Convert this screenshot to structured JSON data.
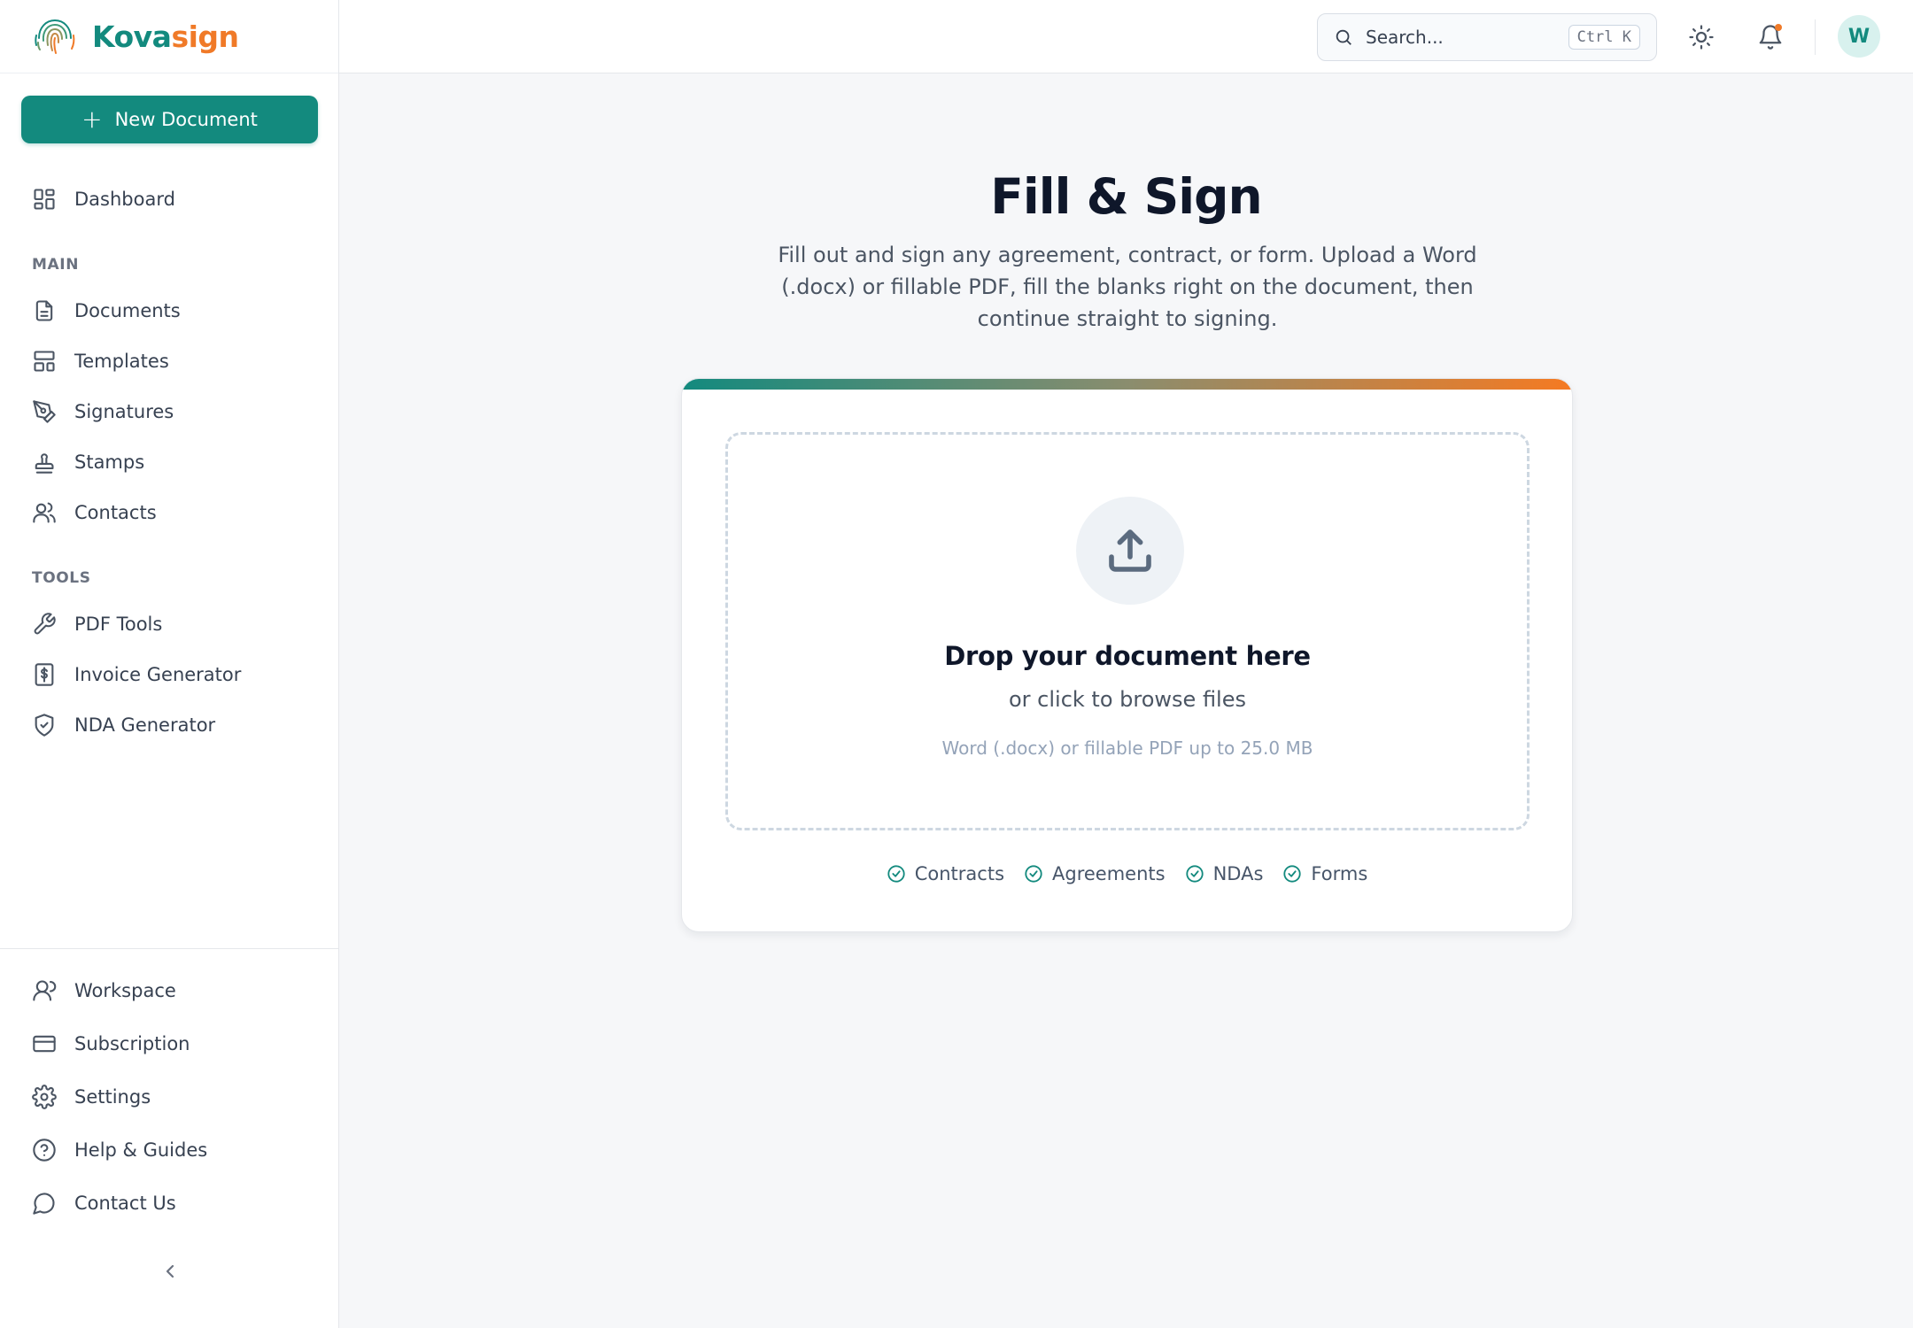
{
  "brand": {
    "part1": "Kova",
    "part2": "sign",
    "accent_teal": "#138a7e",
    "accent_orange": "#f07a28"
  },
  "sidebar": {
    "new_document_label": "New Document",
    "dashboard": {
      "label": "Dashboard",
      "icon": "dashboard-grid-icon"
    },
    "main_section_label": "MAIN",
    "main_items": [
      {
        "label": "Documents",
        "icon": "document-icon"
      },
      {
        "label": "Templates",
        "icon": "template-icon"
      },
      {
        "label": "Signatures",
        "icon": "pen-nib-icon"
      },
      {
        "label": "Stamps",
        "icon": "stamp-icon"
      },
      {
        "label": "Contacts",
        "icon": "users-icon"
      }
    ],
    "tools_section_label": "TOOLS",
    "tools_items": [
      {
        "label": "PDF Tools",
        "icon": "wrench-icon"
      },
      {
        "label": "Invoice Generator",
        "icon": "invoice-icon"
      },
      {
        "label": "NDA Generator",
        "icon": "shield-check-icon"
      }
    ],
    "bottom_items": [
      {
        "label": "Workspace",
        "icon": "user-icon"
      },
      {
        "label": "Subscription",
        "icon": "credit-card-icon"
      },
      {
        "label": "Settings",
        "icon": "gear-icon"
      },
      {
        "label": "Help & Guides",
        "icon": "help-circle-icon"
      },
      {
        "label": "Contact Us",
        "icon": "chat-bubble-icon"
      }
    ]
  },
  "topbar": {
    "search_placeholder": "Search...",
    "search_shortcut": "Ctrl K",
    "avatar_initial": "W"
  },
  "main": {
    "title": "Fill & Sign",
    "subtitle": "Fill out and sign any agreement, contract, or form. Upload a Word (.docx) or fillable PDF, fill the blanks right on the document, then continue straight to signing.",
    "dropzone": {
      "title": "Drop your document here",
      "subtitle": "or click to browse files",
      "hint": "Word (.docx) or fillable PDF up to 25.0 MB"
    },
    "tags": [
      "Contracts",
      "Agreements",
      "NDAs",
      "Forms"
    ]
  }
}
